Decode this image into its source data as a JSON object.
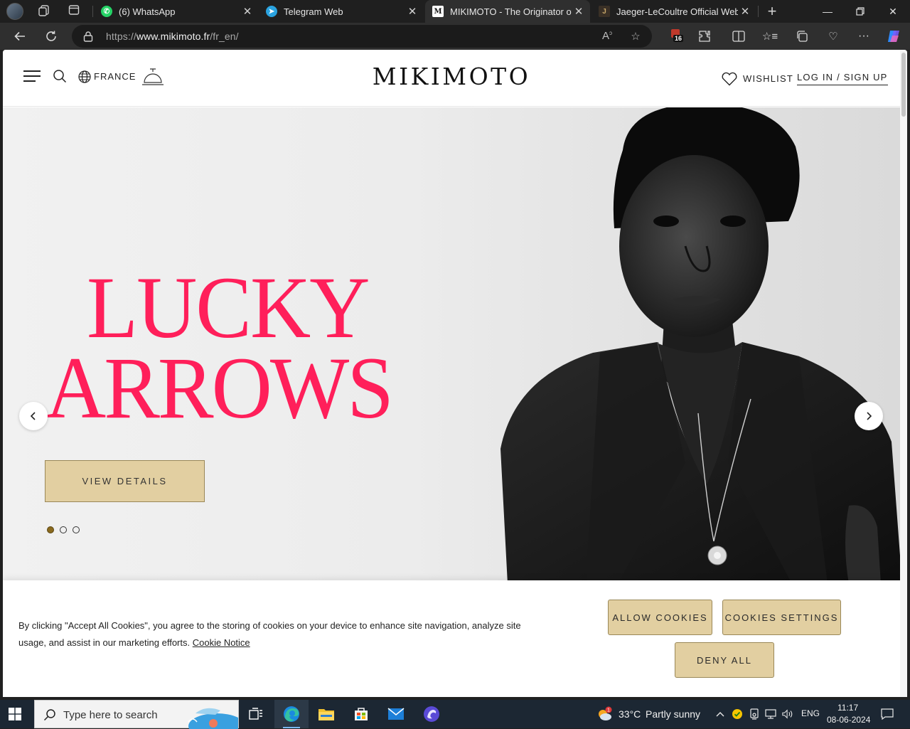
{
  "browser": {
    "tabs": [
      {
        "title": "(6) WhatsApp",
        "active": false
      },
      {
        "title": "Telegram Web",
        "active": false
      },
      {
        "title": "MIKIMOTO - The Originator of C",
        "active": true
      },
      {
        "title": "Jaeger-LeCoultre Official Websi",
        "active": false
      }
    ],
    "url_prefix": "https://",
    "url_host": "www.mikimoto.fr",
    "url_path": "/fr_en/",
    "extension_badge": "16"
  },
  "site": {
    "country": "FRANCE",
    "logo": "MIKIMOTO",
    "wishlist": "WISHLIST",
    "login": "LOG IN / SIGN UP"
  },
  "hero": {
    "title_line1": "LUCKY",
    "title_line2": "ARROWS",
    "cta": "VIEW DETAILS",
    "slide_active": 1,
    "slide_count": 3,
    "accent": "#ff1f5a"
  },
  "cookie": {
    "text": "By clicking \"Accept All Cookies\", you agree to the storing of cookies on your device to enhance site navigation, analyze site usage, and assist in our marketing efforts.",
    "link": "Cookie Notice",
    "allow": "ALLOW COOKIES",
    "settings": "COOKIES SETTINGS",
    "deny": "DENY ALL",
    "button_color": "#e2cfa1"
  },
  "taskbar": {
    "search_placeholder": "Type here to search",
    "weather_temp": "33°C",
    "weather_desc": "Partly sunny",
    "weather_alert": "1",
    "language": "ENG",
    "time": "11:17",
    "date": "08-06-2024"
  }
}
